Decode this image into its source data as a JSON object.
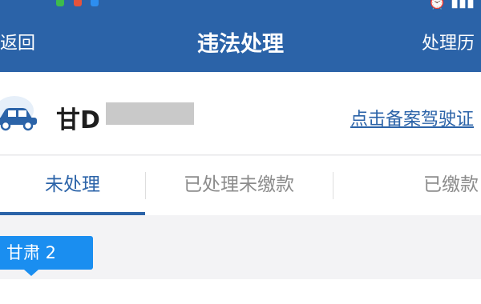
{
  "app": {
    "title": "违法处理",
    "back_label": "返回",
    "history_label": "处理历"
  },
  "vehicle": {
    "plate_prefix": "甘D",
    "register_link": "点击备案驾驶证"
  },
  "tabs": [
    {
      "label": "未处理",
      "active": true
    },
    {
      "label": "已处理未缴款",
      "active": false
    },
    {
      "label": "已缴款",
      "active": false
    }
  ],
  "region_badge": "甘肃 2",
  "colors": {
    "primary": "#2b63a8",
    "badge": "#1a8ef0",
    "background": "#f3f3f5"
  }
}
